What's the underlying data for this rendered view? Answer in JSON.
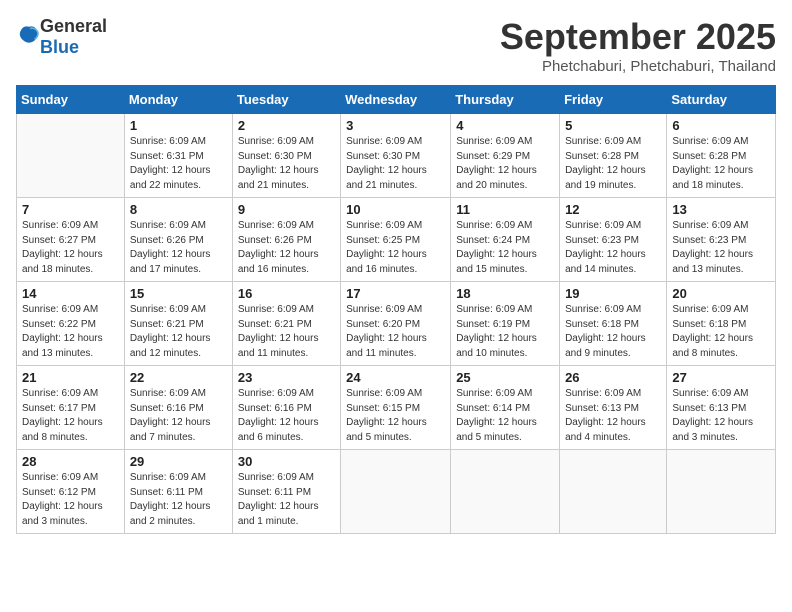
{
  "logo": {
    "text_general": "General",
    "text_blue": "Blue"
  },
  "header": {
    "month": "September 2025",
    "location": "Phetchaburi, Phetchaburi, Thailand"
  },
  "weekdays": [
    "Sunday",
    "Monday",
    "Tuesday",
    "Wednesday",
    "Thursday",
    "Friday",
    "Saturday"
  ],
  "weeks": [
    [
      {
        "day": "",
        "info": ""
      },
      {
        "day": "1",
        "info": "Sunrise: 6:09 AM\nSunset: 6:31 PM\nDaylight: 12 hours\nand 22 minutes."
      },
      {
        "day": "2",
        "info": "Sunrise: 6:09 AM\nSunset: 6:30 PM\nDaylight: 12 hours\nand 21 minutes."
      },
      {
        "day": "3",
        "info": "Sunrise: 6:09 AM\nSunset: 6:30 PM\nDaylight: 12 hours\nand 21 minutes."
      },
      {
        "day": "4",
        "info": "Sunrise: 6:09 AM\nSunset: 6:29 PM\nDaylight: 12 hours\nand 20 minutes."
      },
      {
        "day": "5",
        "info": "Sunrise: 6:09 AM\nSunset: 6:28 PM\nDaylight: 12 hours\nand 19 minutes."
      },
      {
        "day": "6",
        "info": "Sunrise: 6:09 AM\nSunset: 6:28 PM\nDaylight: 12 hours\nand 18 minutes."
      }
    ],
    [
      {
        "day": "7",
        "info": "Sunrise: 6:09 AM\nSunset: 6:27 PM\nDaylight: 12 hours\nand 18 minutes."
      },
      {
        "day": "8",
        "info": "Sunrise: 6:09 AM\nSunset: 6:26 PM\nDaylight: 12 hours\nand 17 minutes."
      },
      {
        "day": "9",
        "info": "Sunrise: 6:09 AM\nSunset: 6:26 PM\nDaylight: 12 hours\nand 16 minutes."
      },
      {
        "day": "10",
        "info": "Sunrise: 6:09 AM\nSunset: 6:25 PM\nDaylight: 12 hours\nand 16 minutes."
      },
      {
        "day": "11",
        "info": "Sunrise: 6:09 AM\nSunset: 6:24 PM\nDaylight: 12 hours\nand 15 minutes."
      },
      {
        "day": "12",
        "info": "Sunrise: 6:09 AM\nSunset: 6:23 PM\nDaylight: 12 hours\nand 14 minutes."
      },
      {
        "day": "13",
        "info": "Sunrise: 6:09 AM\nSunset: 6:23 PM\nDaylight: 12 hours\nand 13 minutes."
      }
    ],
    [
      {
        "day": "14",
        "info": "Sunrise: 6:09 AM\nSunset: 6:22 PM\nDaylight: 12 hours\nand 13 minutes."
      },
      {
        "day": "15",
        "info": "Sunrise: 6:09 AM\nSunset: 6:21 PM\nDaylight: 12 hours\nand 12 minutes."
      },
      {
        "day": "16",
        "info": "Sunrise: 6:09 AM\nSunset: 6:21 PM\nDaylight: 12 hours\nand 11 minutes."
      },
      {
        "day": "17",
        "info": "Sunrise: 6:09 AM\nSunset: 6:20 PM\nDaylight: 12 hours\nand 11 minutes."
      },
      {
        "day": "18",
        "info": "Sunrise: 6:09 AM\nSunset: 6:19 PM\nDaylight: 12 hours\nand 10 minutes."
      },
      {
        "day": "19",
        "info": "Sunrise: 6:09 AM\nSunset: 6:18 PM\nDaylight: 12 hours\nand 9 minutes."
      },
      {
        "day": "20",
        "info": "Sunrise: 6:09 AM\nSunset: 6:18 PM\nDaylight: 12 hours\nand 8 minutes."
      }
    ],
    [
      {
        "day": "21",
        "info": "Sunrise: 6:09 AM\nSunset: 6:17 PM\nDaylight: 12 hours\nand 8 minutes."
      },
      {
        "day": "22",
        "info": "Sunrise: 6:09 AM\nSunset: 6:16 PM\nDaylight: 12 hours\nand 7 minutes."
      },
      {
        "day": "23",
        "info": "Sunrise: 6:09 AM\nSunset: 6:16 PM\nDaylight: 12 hours\nand 6 minutes."
      },
      {
        "day": "24",
        "info": "Sunrise: 6:09 AM\nSunset: 6:15 PM\nDaylight: 12 hours\nand 5 minutes."
      },
      {
        "day": "25",
        "info": "Sunrise: 6:09 AM\nSunset: 6:14 PM\nDaylight: 12 hours\nand 5 minutes."
      },
      {
        "day": "26",
        "info": "Sunrise: 6:09 AM\nSunset: 6:13 PM\nDaylight: 12 hours\nand 4 minutes."
      },
      {
        "day": "27",
        "info": "Sunrise: 6:09 AM\nSunset: 6:13 PM\nDaylight: 12 hours\nand 3 minutes."
      }
    ],
    [
      {
        "day": "28",
        "info": "Sunrise: 6:09 AM\nSunset: 6:12 PM\nDaylight: 12 hours\nand 3 minutes."
      },
      {
        "day": "29",
        "info": "Sunrise: 6:09 AM\nSunset: 6:11 PM\nDaylight: 12 hours\nand 2 minutes."
      },
      {
        "day": "30",
        "info": "Sunrise: 6:09 AM\nSunset: 6:11 PM\nDaylight: 12 hours\nand 1 minute."
      },
      {
        "day": "",
        "info": ""
      },
      {
        "day": "",
        "info": ""
      },
      {
        "day": "",
        "info": ""
      },
      {
        "day": "",
        "info": ""
      }
    ]
  ]
}
